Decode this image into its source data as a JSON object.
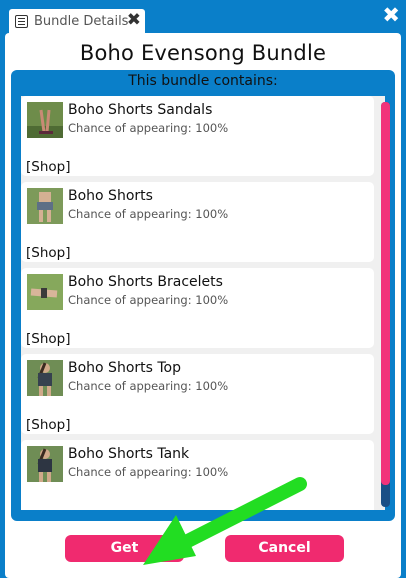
{
  "tab": {
    "label": "Bundle Details",
    "close": "✖",
    "icon": "document-icon"
  },
  "window": {
    "close": "✖"
  },
  "title": "Boho Evensong Bundle",
  "contents_header": "This bundle contains:",
  "items": [
    {
      "name": "Boho Shorts Sandals",
      "chance": "Chance of appearing: 100%",
      "shop": "[Shop]"
    },
    {
      "name": "Boho Shorts",
      "chance": "Chance of appearing: 100%",
      "shop": "[Shop]"
    },
    {
      "name": "Boho Shorts Bracelets",
      "chance": "Chance of appearing: 100%",
      "shop": "[Shop]"
    },
    {
      "name": "Boho Shorts Top",
      "chance": "Chance of appearing: 100%",
      "shop": "[Shop]"
    },
    {
      "name": "Boho Shorts Tank",
      "chance": "Chance of appearing: 100%",
      "shop": ""
    }
  ],
  "buttons": {
    "get": "Get",
    "cancel": "Cancel"
  },
  "colors": {
    "accent": "#0a7fc9",
    "button": "#f02a6f",
    "scroll_thumb": "#f2337a",
    "annotation_arrow": "#22dd22"
  }
}
